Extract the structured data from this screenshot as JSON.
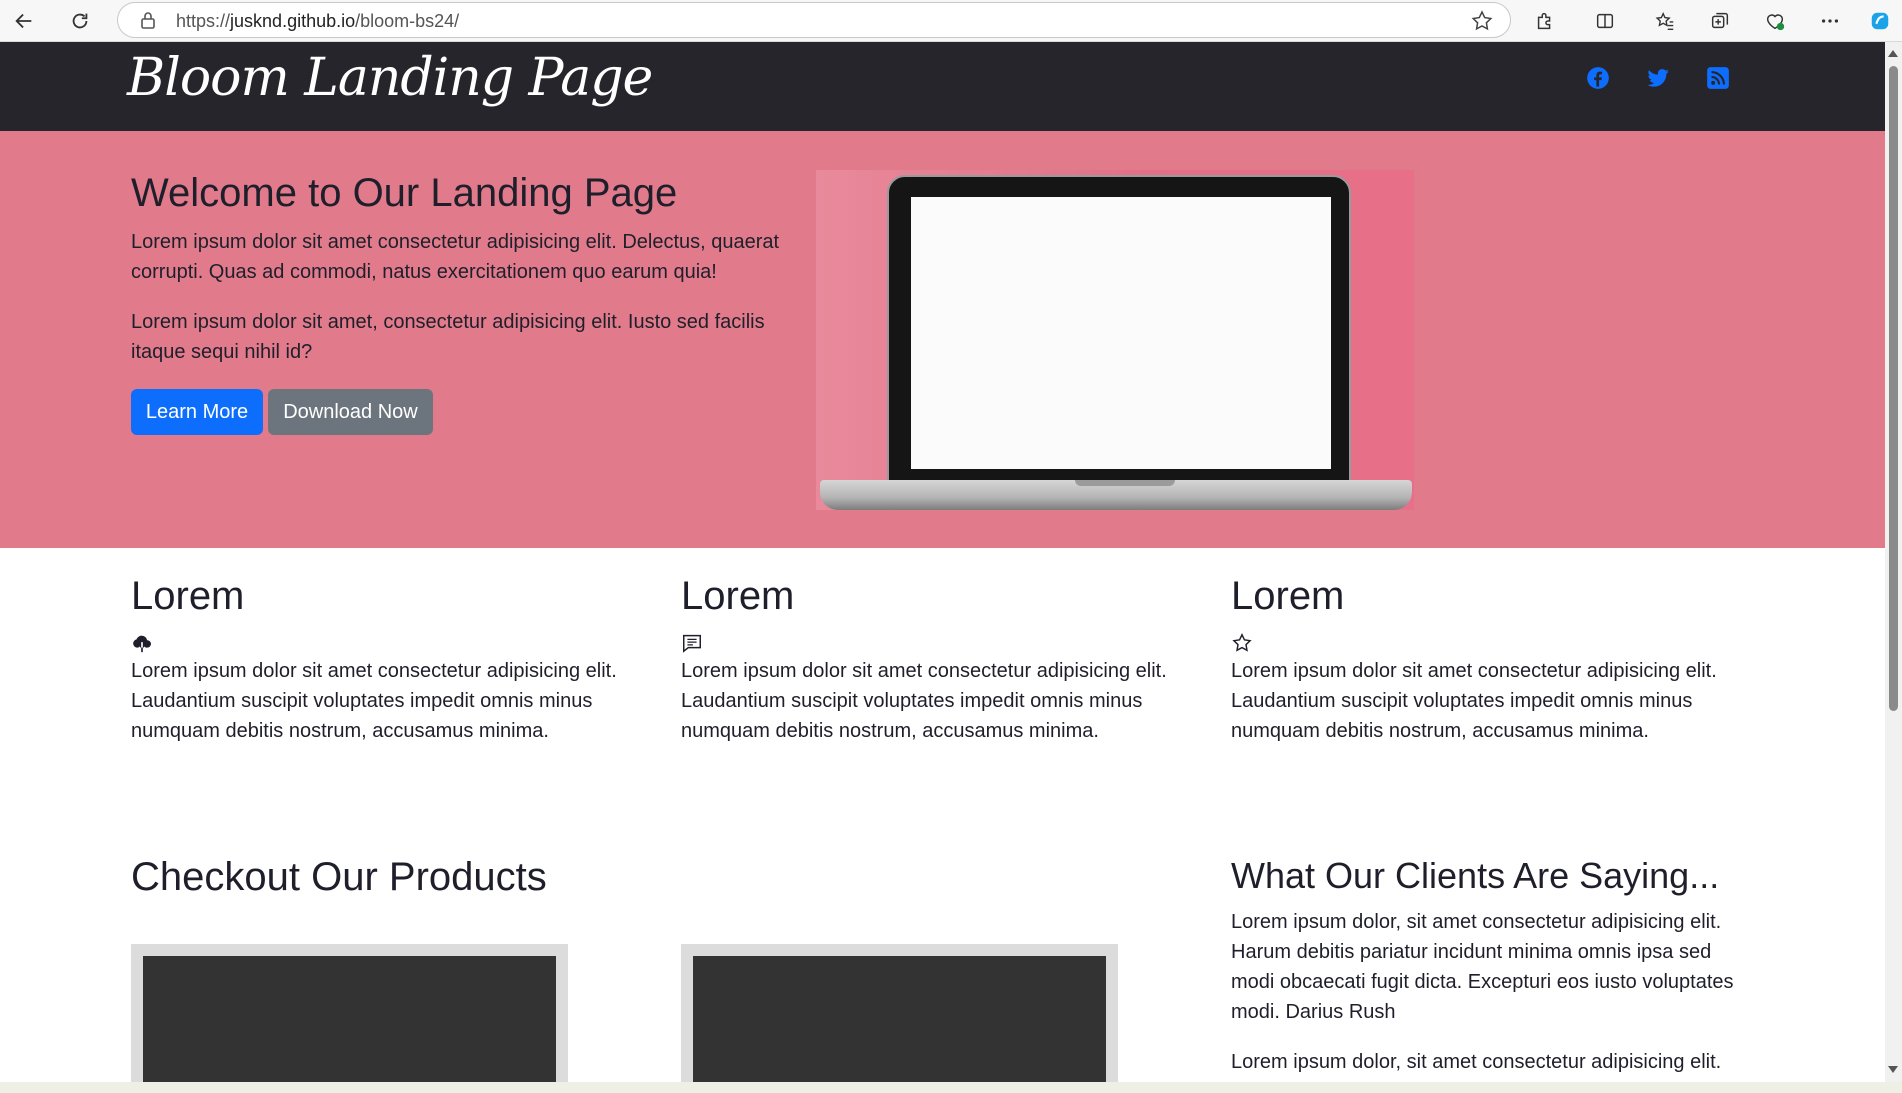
{
  "browser": {
    "url_prefix": "https://",
    "url_host": "jusknd.github.io",
    "url_path": "/bloom-bs24/"
  },
  "nav": {
    "brand": "Bloom Landing Page",
    "social": [
      "facebook-icon",
      "twitter-icon",
      "rss-icon"
    ],
    "social_color": "#0d6efd"
  },
  "hero": {
    "title": "Welcome to Our Landing Page",
    "paragraph1": "Lorem ipsum dolor sit amet consectetur adipisicing elit. Delectus, quaerat corrupti. Quas ad commodi, natus exercitationem quo earum quia!",
    "paragraph2": "Lorem ipsum dolor sit amet, consectetur adipisicing elit. Iusto sed facilis itaque sequi nihil id?",
    "learn_more": "Learn More",
    "download_now": "Download Now",
    "background": "#e17b8b"
  },
  "features": [
    {
      "title": "Lorem",
      "icon": "cloud-download-icon",
      "text": "Lorem ipsum dolor sit amet consectetur adipisicing elit. Laudantium suscipit voluptates impedit omnis minus numquam debitis nostrum, accusamus minima."
    },
    {
      "title": "Lorem",
      "icon": "chat-text-icon",
      "text": "Lorem ipsum dolor sit amet consectetur adipisicing elit. Laudantium suscipit voluptates impedit omnis minus numquam debitis nostrum, accusamus minima."
    },
    {
      "title": "Lorem",
      "icon": "star-icon",
      "text": "Lorem ipsum dolor sit amet consectetur adipisicing elit. Laudantium suscipit voluptates impedit omnis minus numquam debitis nostrum, accusamus minima."
    }
  ],
  "products": {
    "title": "Checkout Our Products"
  },
  "clients": {
    "title": "What Our Clients Are Saying...",
    "quote1": "Lorem ipsum dolor, sit amet consectetur adipisicing elit. Harum debitis pariatur incidunt minima omnis ipsa sed modi obcaecati fugit dicta. Excepturi eos iusto voluptates modi. Darius Rush",
    "quote2": "Lorem ipsum dolor, sit amet consectetur adipisicing elit."
  }
}
